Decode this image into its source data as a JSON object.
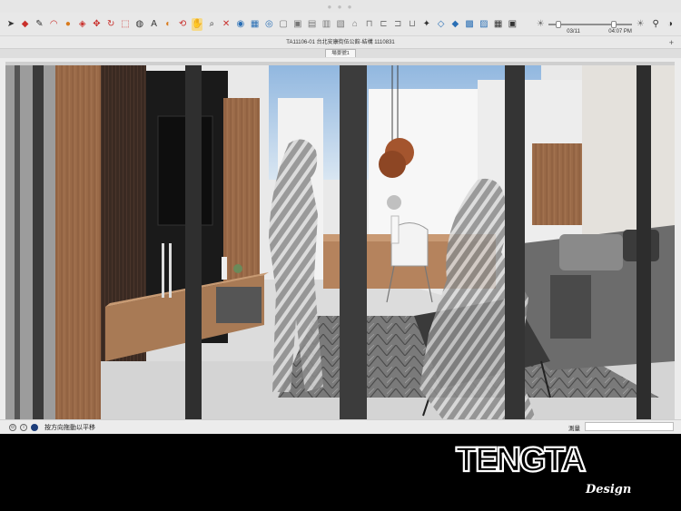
{
  "toolbar": {
    "icons": [
      "select-tool-icon",
      "eraser-icon",
      "pencil-line-icon",
      "arc-tool-icon",
      "paint-bucket-icon",
      "push-pull-icon",
      "move-icon",
      "rotate-icon",
      "scale-icon",
      "tape-measure-icon",
      "text-tool-icon",
      "section-plane-icon",
      "orbit-icon",
      "pan-icon",
      "zoom-icon",
      "zoom-extents-icon",
      "shadows-icon",
      "fog-icon",
      "xray-icon",
      "wireframe-icon",
      "hidden-line-icon",
      "shaded-icon",
      "textured-icon",
      "monochrome-icon",
      "home-view-icon",
      "top-view-icon",
      "front-view-icon",
      "right-view-icon",
      "back-view-icon",
      "left-view-icon",
      "iso-view-icon",
      "components-icon",
      "materials-icon",
      "styles-icon",
      "layers-icon",
      "scenes-icon",
      "camera-icon",
      "walk-icon",
      "look-around-icon",
      "position-camera-icon"
    ],
    "timeline": {
      "date": "03/11",
      "time": "04:07 PM",
      "date_fraction": 0.12,
      "time_fraction": 0.78
    }
  },
  "document": {
    "title": "TA11106-01 台北安康街伍公館-結構 1110831"
  },
  "scene_tab": {
    "label": "場景號1"
  },
  "status": {
    "hint": "按方向拖動以平移",
    "measure_label": "測量",
    "measure_value": ""
  },
  "brand": {
    "logo_text": "TENGTA",
    "script": "Design"
  }
}
